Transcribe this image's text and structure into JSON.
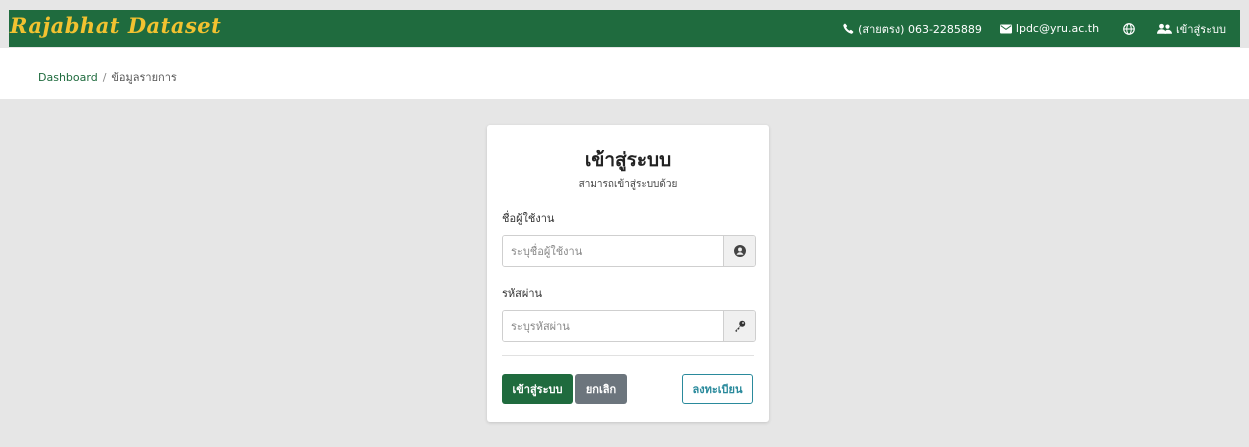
{
  "brand": {
    "title": "Rajabhat Dataset"
  },
  "topnav": {
    "phone": "(สายตรง) 063-2285889",
    "email": "lpdc@yru.ac.th",
    "login": "เข้าสู่ระบบ"
  },
  "breadcrumb": {
    "home": "Dashboard",
    "separator": "/",
    "current": "ข้อมูลรายการ"
  },
  "login_card": {
    "title": "เข้าสู่ระบบ",
    "subtitle": "สามารถเข้าสู่ระบบด้วย",
    "username_label": "ชื่อผู้ใช้งาน",
    "username_placeholder": "ระบุชื่อผู้ใช้งาน",
    "username_value": "",
    "password_label": "รหัสผ่าน",
    "password_placeholder": "ระบุรหัสผ่าน",
    "password_value": "",
    "login_button": "เข้าสู่ระบบ",
    "cancel_button": "ยกเลิก",
    "register_button": "ลงทะเบียน"
  },
  "colors": {
    "header_bg": "#1f6b3e",
    "brand_text": "#f2c230",
    "primary": "#1f6b3e",
    "secondary": "#6c757d",
    "info": "#2a8a9c",
    "page_bg": "#e6e6e6"
  },
  "icons": [
    "phone-icon",
    "envelope-icon",
    "globe-icon",
    "users-icon",
    "user-circle-icon",
    "key-icon"
  ]
}
